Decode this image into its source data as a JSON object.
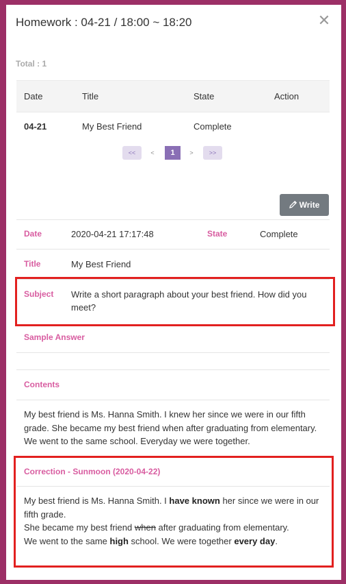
{
  "modal": {
    "title": "Homework : 04-21 / 18:00 ~ 18:20",
    "close_glyph": "✕",
    "total": "Total : 1"
  },
  "table": {
    "headers": [
      "Date",
      "Title",
      "State",
      "Action"
    ],
    "rows": [
      {
        "date": "04-21",
        "title": "My Best Friend",
        "state": "Complete",
        "action": ""
      }
    ]
  },
  "pagination": {
    "first": "<<",
    "prev": "<",
    "current": "1",
    "next": ">",
    "last": ">>"
  },
  "write_button": {
    "label": "Write",
    "icon": "pencil-icon"
  },
  "detail": {
    "date_label": "Date",
    "date_value": "2020-04-21 17:17:48",
    "state_label": "State",
    "state_value": "Complete",
    "title_label": "Title",
    "title_value": "My Best Friend",
    "subject_label": "Subject",
    "subject_value": "Write a short paragraph about your best friend. How did you meet?",
    "sample_label": "Sample Answer",
    "sample_value": "",
    "contents_label": "Contents",
    "contents_value": "My best friend is Ms. Hanna Smith. I knew her since we were in our fifth grade. She became my best friend when after graduating from elementary. We went to the same school. Everyday we were together."
  },
  "correction": {
    "label": "Correction - Sunmoon (2020-04-22)",
    "segments": {
      "s1": "My best friend is Ms. Hanna Smith. I ",
      "b1": "have known",
      "s2": " her since we were in our fifth grade.",
      "s3": "She became my best friend ",
      "del1": "when",
      "s4": " after graduating from elementary.",
      "s5": " We went to the same ",
      "b2": "high",
      "s6": " school. We were together ",
      "b3": "every day",
      "s7": "."
    }
  },
  "colors": {
    "backdrop": "#9c2f66",
    "label_pink": "#d85ca0",
    "highlight_red": "#e2201f",
    "page_active": "#8a6fb5",
    "write_button": "#737a80"
  }
}
